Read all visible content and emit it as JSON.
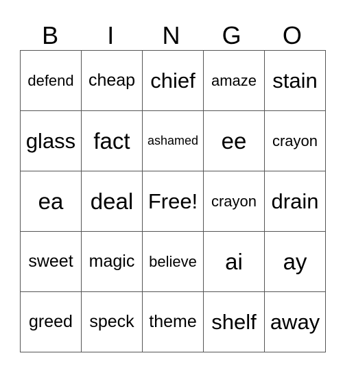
{
  "header": [
    "B",
    "I",
    "N",
    "G",
    "O"
  ],
  "cells": [
    [
      {
        "text": "defend",
        "size": "sm"
      },
      {
        "text": "cheap",
        "size": "md"
      },
      {
        "text": "chief",
        "size": "lg"
      },
      {
        "text": "amaze",
        "size": "sm"
      },
      {
        "text": "stain",
        "size": "lg"
      }
    ],
    [
      {
        "text": "glass",
        "size": "lg"
      },
      {
        "text": "fact",
        "size": "xl"
      },
      {
        "text": "ashamed",
        "size": "xs"
      },
      {
        "text": "ee",
        "size": "xl"
      },
      {
        "text": "crayon",
        "size": "sm"
      }
    ],
    [
      {
        "text": "ea",
        "size": "xl"
      },
      {
        "text": "deal",
        "size": "xl"
      },
      {
        "text": "Free!",
        "size": "lg"
      },
      {
        "text": "crayon",
        "size": "sm"
      },
      {
        "text": "drain",
        "size": "lg"
      }
    ],
    [
      {
        "text": "sweet",
        "size": "md"
      },
      {
        "text": "magic",
        "size": "md"
      },
      {
        "text": "believe",
        "size": "sm"
      },
      {
        "text": "ai",
        "size": "xl"
      },
      {
        "text": "ay",
        "size": "xl"
      }
    ],
    [
      {
        "text": "greed",
        "size": "md"
      },
      {
        "text": "speck",
        "size": "md"
      },
      {
        "text": "theme",
        "size": "md"
      },
      {
        "text": "shelf",
        "size": "lg"
      },
      {
        "text": "away",
        "size": "lg"
      }
    ]
  ]
}
